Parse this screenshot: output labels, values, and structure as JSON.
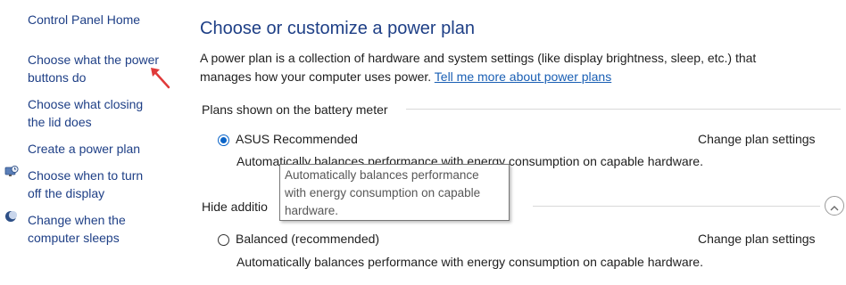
{
  "sidebar": {
    "home": "Control Panel Home",
    "items": [
      {
        "line1": "Choose what the power",
        "line2": "buttons do"
      },
      {
        "line1": "Choose what closing",
        "line2": "the lid does"
      },
      {
        "line1": "Create a power plan",
        "line2": ""
      },
      {
        "line1": "Choose when to turn",
        "line2": "off the display"
      },
      {
        "line1": "Change when the",
        "line2": "computer sleeps"
      }
    ]
  },
  "main": {
    "title": "Choose or customize a power plan",
    "intro_line1": "A power plan is a collection of hardware and system settings (like display brightness, sleep, etc.) that",
    "intro_line2": "manages how your computer uses power.",
    "tell_more_link": "Tell me more about power plans",
    "battery_section_label": "Plans shown on the battery meter",
    "hide_section_label": "Hide additio",
    "plans": [
      {
        "name": "ASUS Recommended",
        "selected": true,
        "change_link": "Change plan settings",
        "description": "Automatically balances performance with energy consumption on capable hardware."
      },
      {
        "name": "Balanced (recommended)",
        "selected": false,
        "change_link": "Change plan settings",
        "description": "Automatically balances performance with energy consumption on capable hardware."
      }
    ]
  },
  "tooltip": {
    "line1": "Automatically balances performance",
    "line2": "with energy consumption on capable",
    "line3": "hardware."
  },
  "colors": {
    "link": "#1a5fb4",
    "title": "#1e3f86",
    "annotation_arrow": "#e03a3a"
  },
  "icons": {
    "display": "monitor-clock-icon",
    "sleep": "moon-icon",
    "collapse": "chevron-up-icon",
    "annotation": "red-arrow-icon"
  }
}
